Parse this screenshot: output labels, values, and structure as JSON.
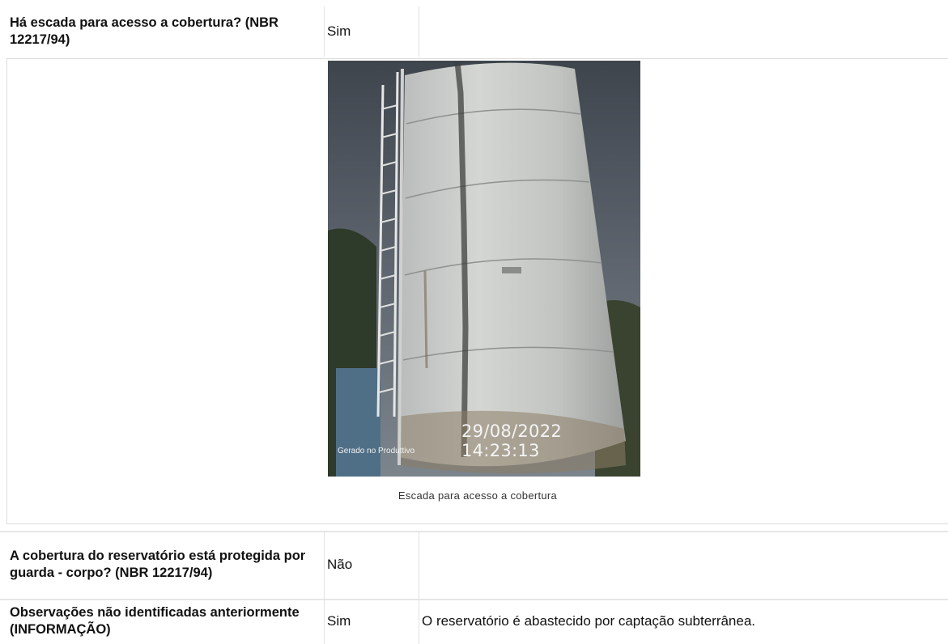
{
  "rows": [
    {
      "question": "Há escada para acesso a cobertura? (NBR 12217/94)",
      "answer": "Sim",
      "observation": ""
    },
    {
      "question": "A cobertura do reservatório está protegida por guarda - corpo? (NBR 12217/94)",
      "answer": "Não",
      "observation": ""
    },
    {
      "question": "Observações não identificadas anteriormente (INFORMAÇÃO)",
      "answer": "Sim",
      "observation": "O reservatório é abastecido por captação subterrânea."
    }
  ],
  "photo": {
    "caption": "Escada para acesso a cobertura",
    "watermark_app": "Gerado no Produttivo",
    "watermark_datetime": "29/08/2022 14:23:13"
  }
}
